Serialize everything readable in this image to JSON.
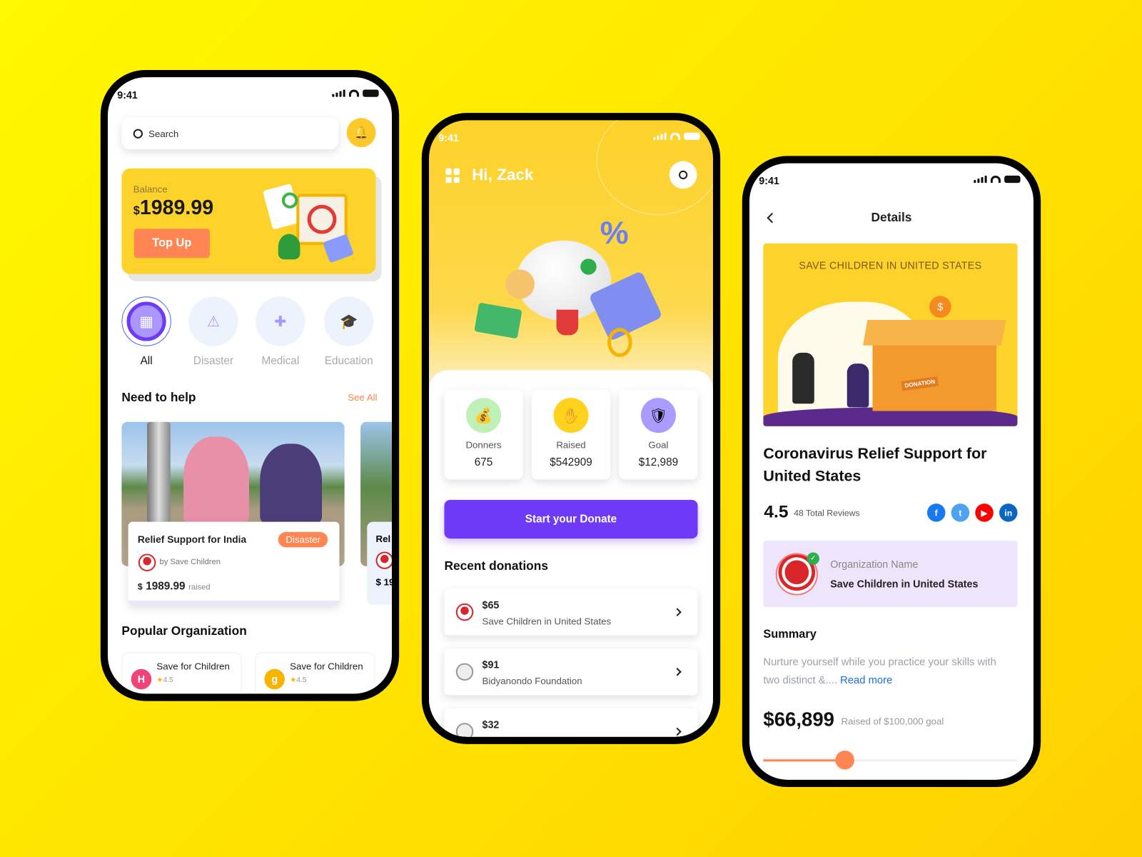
{
  "colors": {
    "background": "#FFE600",
    "accent_yellow": "#FDD22A",
    "accent_orange": "#FF8552",
    "accent_purple": "#6F3AF5"
  },
  "status": {
    "time": "9:41"
  },
  "home": {
    "search_placeholder": "Search",
    "bell_icon": "bell-icon",
    "balance_label": "Balance",
    "balance_currency": "$",
    "balance_value": "1989.99",
    "topup_label": "Top Up",
    "categories": [
      {
        "label": "All",
        "icon": "grid-icon",
        "active": true
      },
      {
        "label": "Disaster",
        "icon": "warning-icon"
      },
      {
        "label": "Medical",
        "icon": "medkit-icon"
      },
      {
        "label": "Education",
        "icon": "graduation-cap-icon"
      }
    ],
    "need_help_title": "Need to help",
    "see_all": "See All",
    "campaign": {
      "title": "Relief Support for India",
      "tag": "Disaster",
      "by": "by Save Children",
      "currency": "$",
      "amount": "1989.99",
      "raised": "raised"
    },
    "campaign_peek": {
      "title": "Rel",
      "amount": "$ 19"
    },
    "popular_title": "Popular Organization",
    "orgs": [
      {
        "name": "Save for Children",
        "rating": "4.5",
        "color": "#F0437A"
      },
      {
        "name": "Save for Children",
        "rating": "4.5",
        "color": "#F7B500"
      }
    ]
  },
  "dashboard": {
    "greeting": "Hi, Zack",
    "stats": [
      {
        "label": "Donners",
        "value": "675",
        "icon": "money-bag-icon",
        "color": "#BFF0B8"
      },
      {
        "label": "Raised",
        "value": "$542909",
        "icon": "hand-coin-icon",
        "color": "#FFD21F"
      },
      {
        "label": "Goal",
        "value": "$12,989",
        "icon": "shield-icon",
        "color": "#A99BFF"
      }
    ],
    "donate_button": "Start your Donate",
    "recent_title": "Recent donations",
    "donations": [
      {
        "amount": "$65",
        "org": "Save Children in United States"
      },
      {
        "amount": "$91",
        "org": "Bidyanondo Foundation"
      },
      {
        "amount": "$32",
        "org": ""
      }
    ]
  },
  "details": {
    "title": "Details",
    "banner_title": "SAVE CHILDREN IN UNITED STATES",
    "banner_box_label": "DONATION",
    "campaign_title": "Coronavirus Relief Support for United States",
    "rating": "4.5",
    "reviews": "48 Total Reviews",
    "social": [
      {
        "icon": "facebook-icon",
        "color": "#1877F2",
        "glyph": "f"
      },
      {
        "icon": "twitter-icon",
        "color": "#4DA3F0",
        "glyph": "t"
      },
      {
        "icon": "youtube-icon",
        "color": "#FF0000",
        "glyph": "▶"
      },
      {
        "icon": "linkedin-icon",
        "color": "#0A66C2",
        "glyph": "in"
      }
    ],
    "org_label": "Organization Name",
    "org_name": "Save Children in United States",
    "summary_title": "Summary",
    "summary_text": "Nurture yourself while you practice your skills with two distinct &....",
    "read_more": "Read more",
    "raised_amount": "$66,899",
    "raised_goal": "Raised of $100,000 goal",
    "slider_value": 0.32
  }
}
